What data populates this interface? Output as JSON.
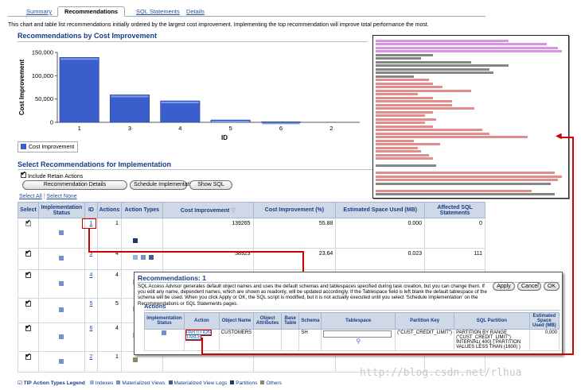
{
  "tabs": [
    {
      "label": "Summary",
      "active": false
    },
    {
      "label": "Recommendations",
      "active": true
    },
    {
      "label": "SQL Statements",
      "active": false
    },
    {
      "label": "Details",
      "active": false
    }
  ],
  "intro_text": "This chart and table list recommendations initially ordered by the largest cost improvement. Implementing the top recommendation will improve total performance the most.",
  "chart_section_title": "Recommendations by Cost Improvement",
  "chart_data": {
    "type": "bar",
    "categories": [
      "1",
      "3",
      "4",
      "5",
      "6",
      "2"
    ],
    "series": [
      {
        "name": "Cost Improvement",
        "values": [
          139265,
          58923,
          46000,
          5000,
          1000,
          0
        ]
      }
    ],
    "xlabel": "ID",
    "ylabel": "Cost Improvement",
    "yticks": [
      "0",
      "50,000",
      "100,000",
      "150,000"
    ],
    "ylim": [
      0,
      150000
    ],
    "bar_color": "#3a5fcd",
    "legend_position": "bottom-left"
  },
  "select_section_title": "Select Recommendations for Implementation",
  "retain_actions_label": "Include Retain Actions",
  "buttons": {
    "details": "Recommendation Details",
    "schedule": "Schedule Implementation",
    "show_sql": "Show SQL"
  },
  "select_all": "Select All",
  "select_none": "Select None",
  "table_headers": [
    "Select",
    "Implementation Status",
    "ID",
    "Actions",
    "Action Types",
    "Cost Improvement",
    "Cost Improvement (%)",
    "Estimated Space Used (MB)",
    "Affected SQL Statements"
  ],
  "rows": [
    {
      "id": "1",
      "actions": "1",
      "cost": "139265",
      "cost_pct": "55.88",
      "space": "0.000",
      "affected": "0",
      "checked": true,
      "disabled": true
    },
    {
      "id": "3",
      "actions": "4",
      "cost": "58923",
      "cost_pct": "23.64",
      "space": "0.023",
      "affected": "111",
      "checked": true,
      "disabled": false
    },
    {
      "id": "4",
      "actions": "4",
      "cost": "",
      "cost_pct": "",
      "space": "",
      "affected": "",
      "checked": true,
      "disabled": false
    },
    {
      "id": "5",
      "actions": "5",
      "cost": "",
      "cost_pct": "",
      "space": "",
      "affected": "",
      "checked": true,
      "disabled": false
    },
    {
      "id": "6",
      "actions": "4",
      "cost": "",
      "cost_pct": "",
      "space": "",
      "affected": "",
      "checked": true,
      "disabled": false
    },
    {
      "id": "2",
      "actions": "1",
      "cost": "",
      "cost_pct": "",
      "space": "",
      "affected": "",
      "checked": true,
      "disabled": false
    }
  ],
  "tip": {
    "label": "TIP",
    "legend_title": "Action Types Legend",
    "items": [
      {
        "label": "Indexes",
        "color": "#8fb8dc"
      },
      {
        "label": "Materialized Views",
        "color": "#6f94c6"
      },
      {
        "label": "Materialized View Logs",
        "color": "#3c5f8f"
      },
      {
        "label": "Partitions",
        "color": "#1f3b66"
      },
      {
        "label": "Others",
        "color": "#8c8c5a"
      }
    ]
  },
  "popup": {
    "title": "Recommendations: 1",
    "description": "SQL Access Advisor generates default object names and uses the default schemas and tablespaces specified during task creation, but you can change them. If you edit any name, dependent names, which are shown as readonly, will be updated accordingly. If the Tablespace field is left blank the default tablespace of the schema will be used. When you click Apply or OK, the SQL script is modified, but it is not actually executed until you select 'Schedule Implementation' on the Recommendations or SQL Statements pages.",
    "apply": "Apply",
    "cancel": "Cancel",
    "ok": "OK",
    "actions_title": "Actions",
    "headers": [
      "Implementation Status",
      "Action",
      "Object Name",
      "Object Attributes",
      "Base Table",
      "Schema",
      "Tablespace",
      "Partition Key",
      "SQL Partition",
      "Estimated Space Used (MB)"
    ],
    "row": {
      "action": "PARTITION TABLE",
      "object_name": "CUSTOMERS",
      "object_attributes": "",
      "base_table": "",
      "schema": "SH",
      "tablespace": "",
      "partition_key": "(\"CUST_CREDIT_LIMIT\")",
      "sql_partition": "PARTITION BY RANGE (\"CUST_CREDIT_LIMIT\") INTERVAL( 400) ( PARTITION VALUES LESS THAN (1600) )",
      "space": "0.000"
    }
  },
  "watermark": "http://blog.csdn.net/rlhua"
}
